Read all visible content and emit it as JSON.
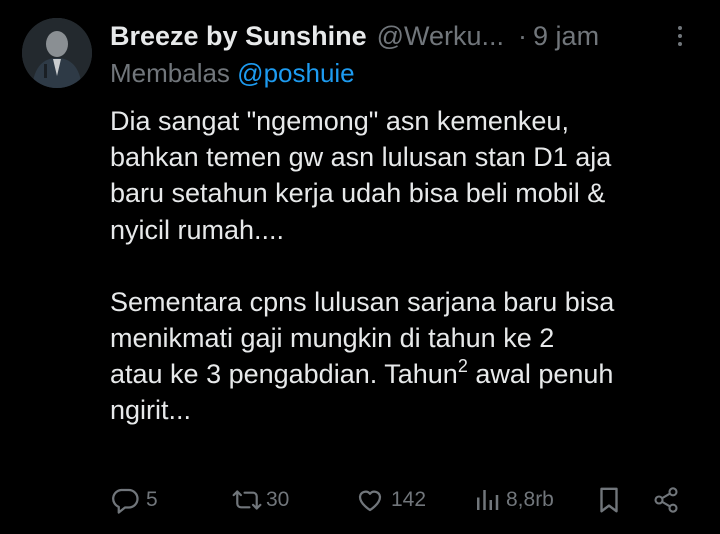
{
  "tweet": {
    "author_name": "Breeze by Sunshine",
    "author_handle": "@Werku...",
    "separator": "·",
    "time": "9 jam",
    "reply_prefix": "Membalas",
    "reply_to": "@poshuie",
    "paragraph1": [
      "Dia sangat \"ngemong\" asn kemenkeu,",
      "bahkan temen gw asn lulusan stan D1 aja",
      "baru setahun kerja udah bisa beli mobil &",
      "nyicil rumah...."
    ],
    "paragraph2_line1": "Sementara cpns lulusan sarjana baru bisa",
    "paragraph2_line2": "menikmati gaji mungkin di tahun ke 2",
    "paragraph2_line3_a": "atau ke 3 pengabdian. Tahun",
    "paragraph2_line3_sup": "2",
    "paragraph2_line3_b": " awal penuh",
    "paragraph2_line4": "ngirit..."
  },
  "actions": {
    "replies": "5",
    "reposts": "30",
    "likes": "142",
    "views": "8,8rb"
  },
  "icons": [
    "more-icon",
    "reply-icon",
    "repost-icon",
    "like-icon",
    "views-icon",
    "bookmark-icon",
    "share-icon"
  ],
  "colors": {
    "background": "#000000",
    "text": "#e7e9ea",
    "muted": "#71767b",
    "link": "#1d9bf0"
  }
}
